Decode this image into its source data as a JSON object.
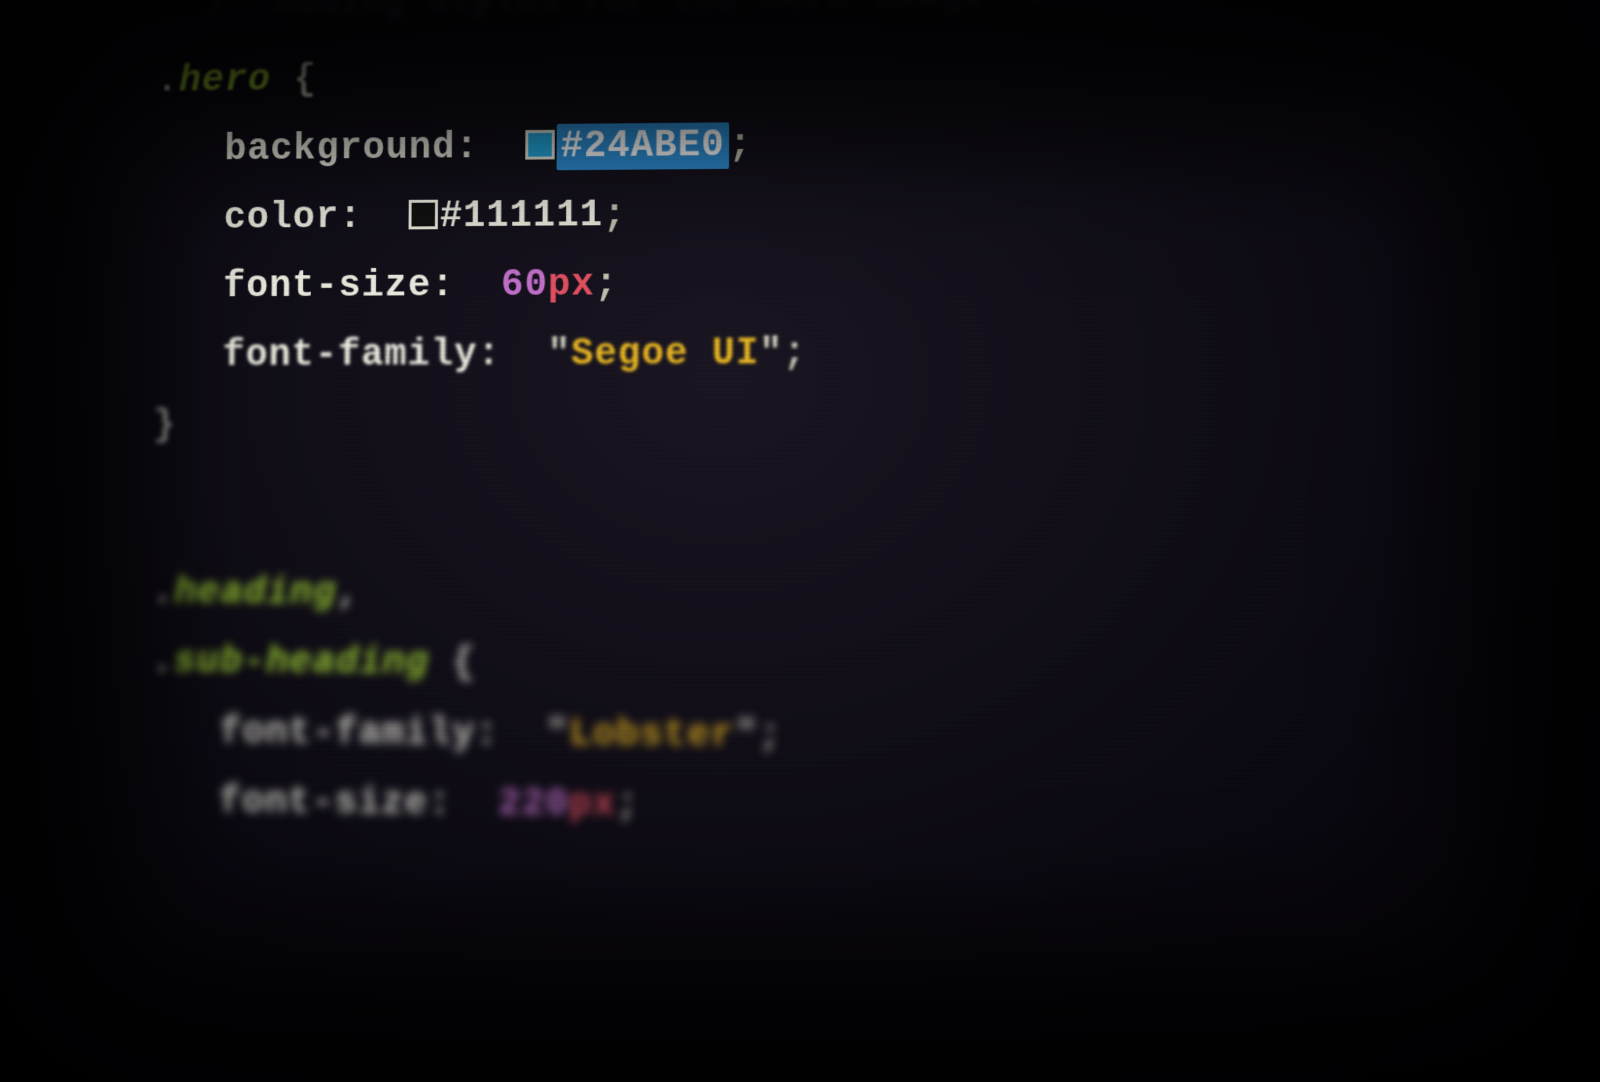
{
  "comment": "/* Adding styles for the hero image */",
  "rules": [
    {
      "selectors": [
        "hero"
      ],
      "declarations": {
        "background": {
          "property": "background",
          "hex": "#24ABE0",
          "swatch_color": "#24ABE0",
          "highlighted": true
        },
        "color": {
          "property": "color",
          "hex": "#111111",
          "swatch_color": "#111111"
        },
        "font_size": {
          "property": "font-size",
          "number": "60",
          "unit": "px"
        },
        "font_family": {
          "property": "font-family",
          "quote": "\"",
          "value": "Segoe UI"
        }
      }
    },
    {
      "selectors": [
        "heading",
        "sub-heading"
      ],
      "declarations": {
        "font_family": {
          "property": "font-family",
          "quote": "\"",
          "value": "Lobster"
        },
        "font_size": {
          "property": "font-size",
          "number": "220",
          "unit": "px"
        }
      }
    }
  ],
  "punct": {
    "dot": ".",
    "open": "{",
    "close": "}",
    "colon": ":",
    "semi": ";",
    "comma": ","
  }
}
